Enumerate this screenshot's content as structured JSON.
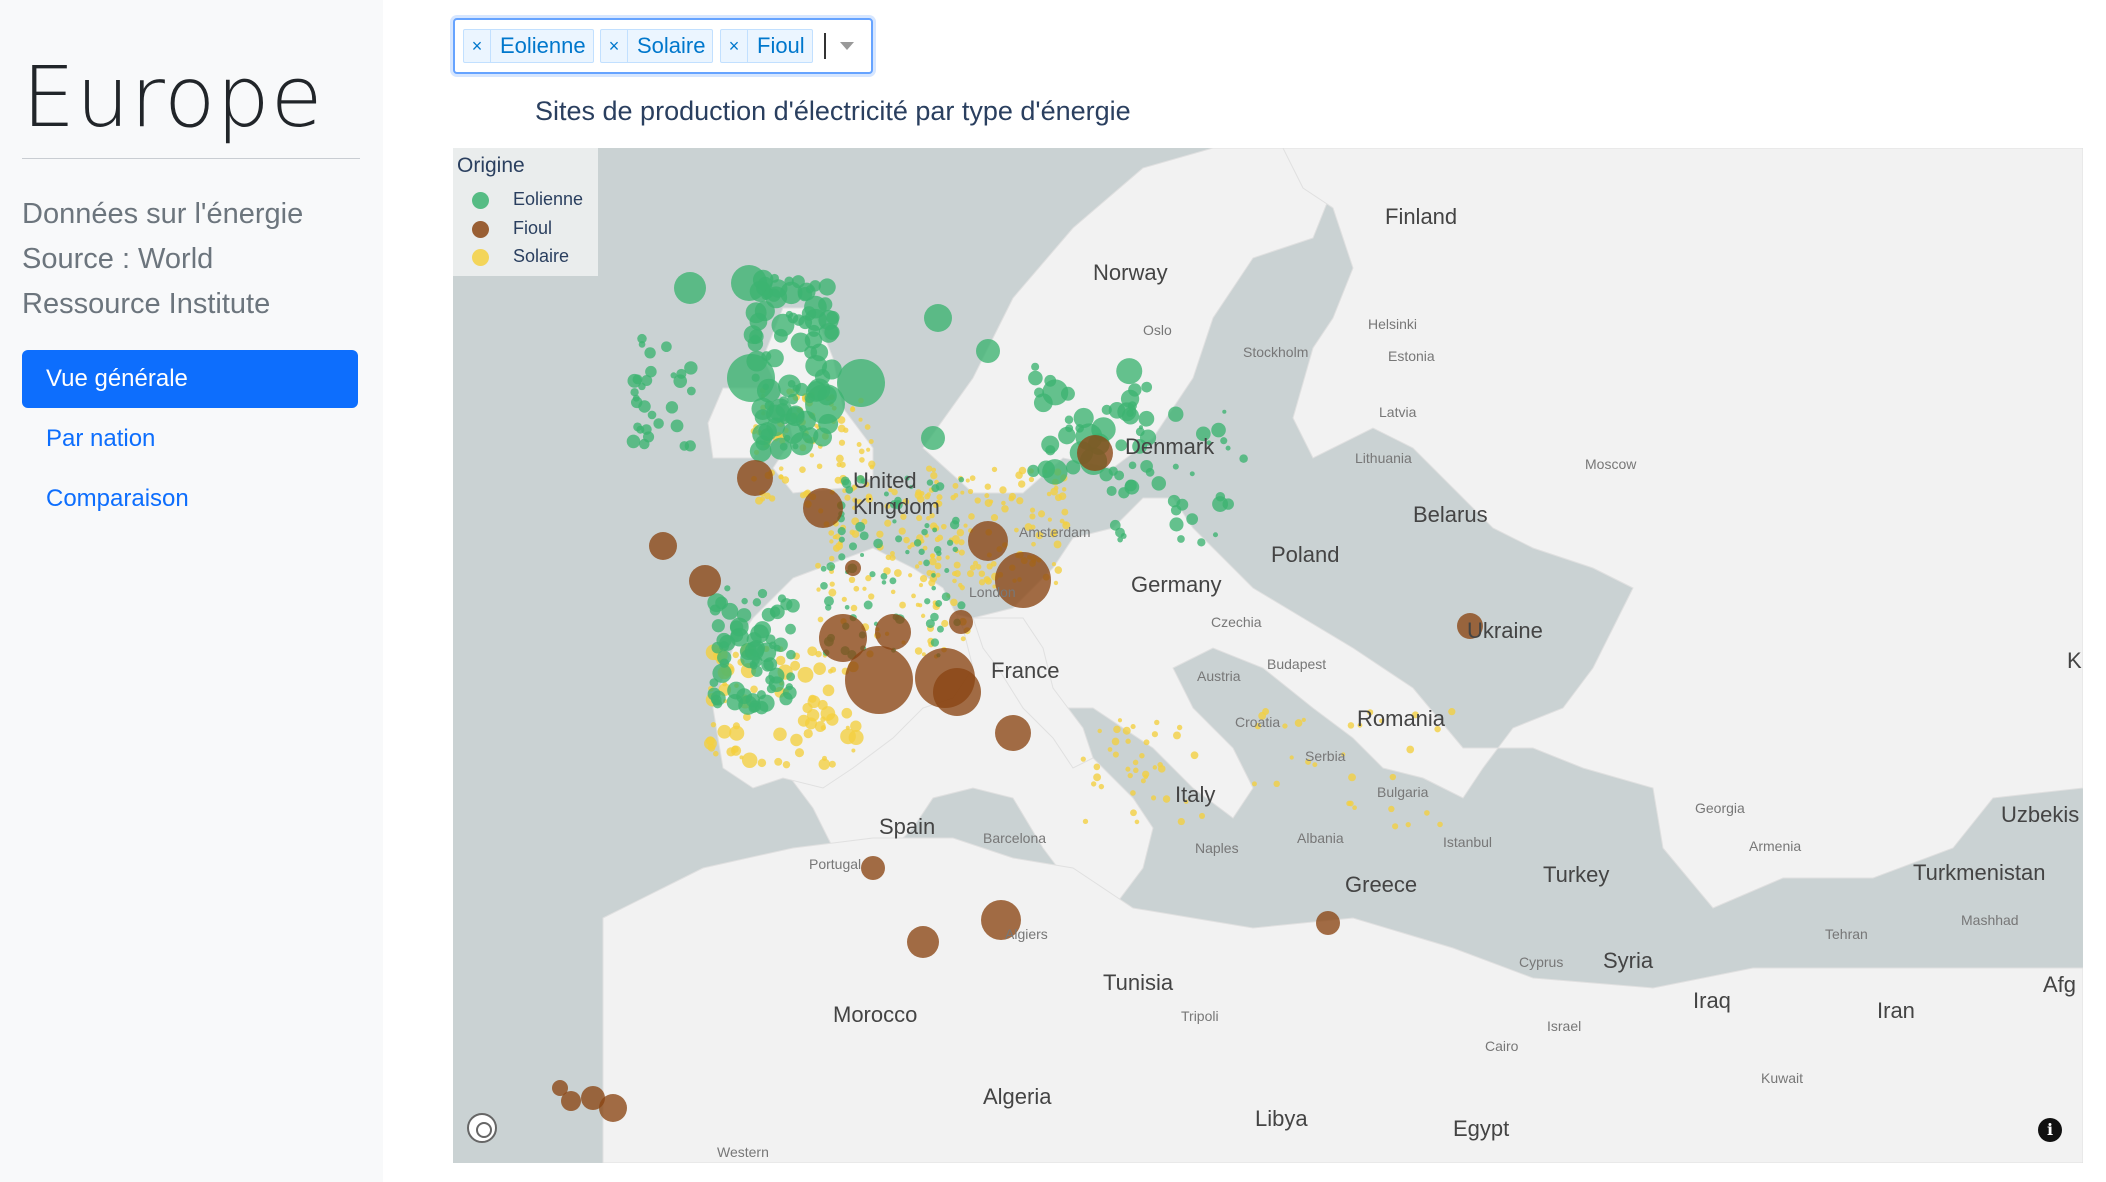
{
  "sidebar": {
    "title": "Europe",
    "description": "Données sur l'énergie Source : World Ressource Institute",
    "nav": [
      {
        "label": "Vue générale",
        "active": true
      },
      {
        "label": "Par nation",
        "active": false
      },
      {
        "label": "Comparaison",
        "active": false
      }
    ]
  },
  "filter": {
    "selected": [
      "Eolienne",
      "Solaire",
      "Fioul"
    ],
    "remove_glyph": "×"
  },
  "chart": {
    "title": "Sites de production d'électricité par type d'énergie",
    "legend_title": "Origine",
    "legend": [
      {
        "label": "Eolienne",
        "color": "#3cb371"
      },
      {
        "label": "Fioul",
        "color": "#8b4513"
      },
      {
        "label": "Solaire",
        "color": "#f4d03f"
      }
    ],
    "map_labels_large": [
      "Finland",
      "Norway",
      "Denmark",
      "United Kingdom",
      "Belarus",
      "Poland",
      "Germany",
      "Ukraine",
      "France",
      "Romania",
      "Italy",
      "Spain",
      "Turkey",
      "Greece",
      "Syria",
      "Iraq",
      "Iran",
      "Turkmenistan",
      "Uzbekis",
      "Tunisia",
      "Morocco",
      "Algeria",
      "Libya",
      "Egypt",
      "Afg",
      "K"
    ],
    "map_labels_small": [
      "Oslo",
      "Stockholm",
      "Helsinki",
      "Estonia",
      "Latvia",
      "Lithuania",
      "Moscow",
      "Amsterdam",
      "Czechia",
      "Austria",
      "Budapest",
      "Croatia",
      "Serbia",
      "Bulgaria",
      "Albania",
      "Naples",
      "Istanbul",
      "Georgia",
      "Armenia",
      "Tehran",
      "Mashhad",
      "Barcelona",
      "Portugal",
      "Algiers",
      "Tripoli",
      "Cairo",
      "Israel",
      "Kuwait",
      "Cyprus",
      "London",
      "Western"
    ],
    "icons": {
      "compass": "compass-icon",
      "info": "info-icon"
    }
  }
}
